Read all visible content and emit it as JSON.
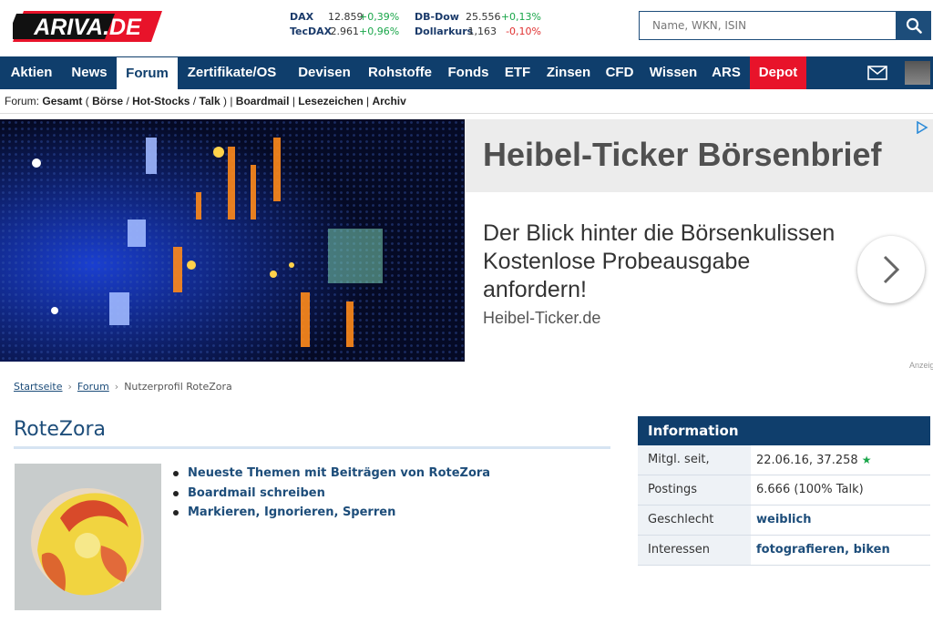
{
  "header": {
    "logo_text": "ARIVA.DE",
    "search_placeholder": "Name, WKN, ISIN"
  },
  "ticker": [
    {
      "name": "DAX",
      "value": "12.859",
      "change": "+0,39%",
      "trend": "up"
    },
    {
      "name": "TecDAX",
      "value": "2.961",
      "change": "+0,96%",
      "trend": "up"
    },
    {
      "name": "DB-Dow",
      "value": "25.556",
      "change": "+0,13%",
      "trend": "up"
    },
    {
      "name": "Dollarkurs",
      "value": "1,163",
      "change": "-0,10%",
      "trend": "down"
    }
  ],
  "nav": {
    "items": [
      "Aktien",
      "News",
      "Forum",
      "Zertifikate/OS",
      "Devisen",
      "Rohstoffe",
      "Fonds",
      "ETF",
      "Zinsen",
      "CFD",
      "Wissen",
      "ARS",
      "Depot"
    ],
    "active": "Forum",
    "highlight": "Depot"
  },
  "forumbar": {
    "prefix": "Forum:",
    "gesamt": "Gesamt",
    "open_paren": "(",
    "boerse": "Börse",
    "slash1": "/",
    "hotstocks": "Hot-Stocks",
    "slash2": "/",
    "talk": "Talk",
    "close_paren": ")",
    "sep1": "|",
    "boardmail": "Boardmail",
    "sep2": "|",
    "lesezeichen": "Lesezeichen",
    "sep3": "|",
    "archiv": "Archiv"
  },
  "ad": {
    "title": "Heibel-Ticker Börsenbrief",
    "line1": "Der Blick hinter die Börsenkulissen",
    "line2": "Kostenlose Probeausgabe",
    "line3": "anfordern!",
    "url": "Heibel-Ticker.de",
    "label": "Anzeige"
  },
  "breadcrumb": {
    "home": "Startseite",
    "forum": "Forum",
    "current": "Nutzerprofil RoteZora"
  },
  "profile": {
    "username": "RoteZora",
    "actions": [
      "Neueste Themen mit Beiträgen von RoteZora",
      "Boardmail schreiben",
      "Markieren, Ignorieren, Sperren"
    ]
  },
  "info": {
    "title": "Information",
    "rows": [
      {
        "label": "Mitgl. seit, Sterne",
        "value": "22.06.16, 37.258"
      },
      {
        "label": "Postings",
        "value": "6.666 (100% Talk)"
      },
      {
        "label": "Geschlecht",
        "value": "weiblich"
      },
      {
        "label": "Interessen",
        "value": "fotografieren, biken"
      }
    ]
  },
  "colors": {
    "brand_navy": "#0f3e6c",
    "depot_red": "#e8132a",
    "positive": "#1aa64a",
    "negative": "#e03030"
  }
}
